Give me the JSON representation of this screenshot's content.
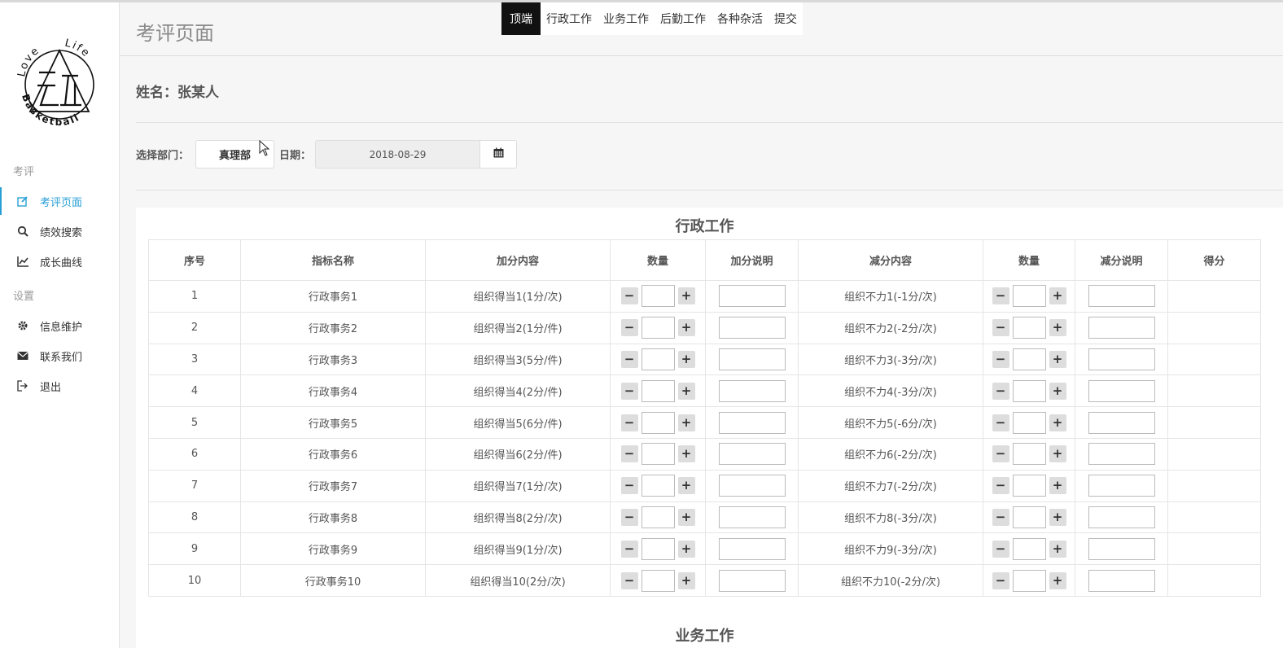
{
  "sidebar": {
    "logo": {
      "text_top": "Love  Life",
      "text_bottom": "Basketball"
    },
    "section_review": "考评",
    "section_settings": "设置",
    "items": [
      {
        "label": "考评页面",
        "icon": "edit-icon",
        "active": true
      },
      {
        "label": "绩效搜索",
        "icon": "search-icon"
      },
      {
        "label": "成长曲线",
        "icon": "line-chart-icon"
      },
      {
        "label": "信息维护",
        "icon": "gear-icon"
      },
      {
        "label": "联系我们",
        "icon": "envelope-icon"
      },
      {
        "label": "退出",
        "icon": "sign-out-icon"
      }
    ]
  },
  "header": {
    "title": "考评页面"
  },
  "topnav": {
    "tabs": [
      "顶端",
      "行政工作",
      "业务工作",
      "后勤工作",
      "各种杂活",
      "提交"
    ],
    "active": 0
  },
  "person": {
    "label": "姓名：",
    "name": "张某人"
  },
  "filters": {
    "dept_label": "选择部门：",
    "dept_value": "真理部",
    "date_label": "日期：",
    "date_value": "2018-08-29",
    "calendar_icon": "calendar-icon"
  },
  "section": {
    "title": "行政工作",
    "columns": [
      "序号",
      "指标名称",
      "加分内容",
      "数量",
      "加分说明",
      "减分内容",
      "数量",
      "减分说明",
      "得分"
    ],
    "rows": [
      {
        "no": "1",
        "name": "行政事务1",
        "plus": "组织得当1(1分/次)",
        "minus": "组织不力1(-1分/次)"
      },
      {
        "no": "2",
        "name": "行政事务2",
        "plus": "组织得当2(1分/件)",
        "minus": "组织不力2(-2分/次)"
      },
      {
        "no": "3",
        "name": "行政事务3",
        "plus": "组织得当3(5分/件)",
        "minus": "组织不力3(-3分/次)"
      },
      {
        "no": "4",
        "name": "行政事务4",
        "plus": "组织得当4(2分/件)",
        "minus": "组织不力4(-3分/次)"
      },
      {
        "no": "5",
        "name": "行政事务5",
        "plus": "组织得当5(6分/件)",
        "minus": "组织不力5(-6分/次)"
      },
      {
        "no": "6",
        "name": "行政事务6",
        "plus": "组织得当6(2分/件)",
        "minus": "组织不力6(-2分/次)"
      },
      {
        "no": "7",
        "name": "行政事务7",
        "plus": "组织得当7(1分/次)",
        "minus": "组织不力7(-2分/次)"
      },
      {
        "no": "8",
        "name": "行政事务8",
        "plus": "组织得当8(2分/次)",
        "minus": "组织不力8(-3分/次)"
      },
      {
        "no": "9",
        "name": "行政事务9",
        "plus": "组织得当9(1分/次)",
        "minus": "组织不力9(-3分/次)"
      },
      {
        "no": "10",
        "name": "行政事务10",
        "plus": "组织得当10(2分/次)",
        "minus": "组织不力10(-2分/次)"
      }
    ]
  },
  "next_section": {
    "title": "业务工作"
  },
  "stepper": {
    "minus": "−",
    "plus": "+"
  },
  "colors": {
    "accent": "#2a9fd6",
    "active_tab_bg": "#111111"
  }
}
